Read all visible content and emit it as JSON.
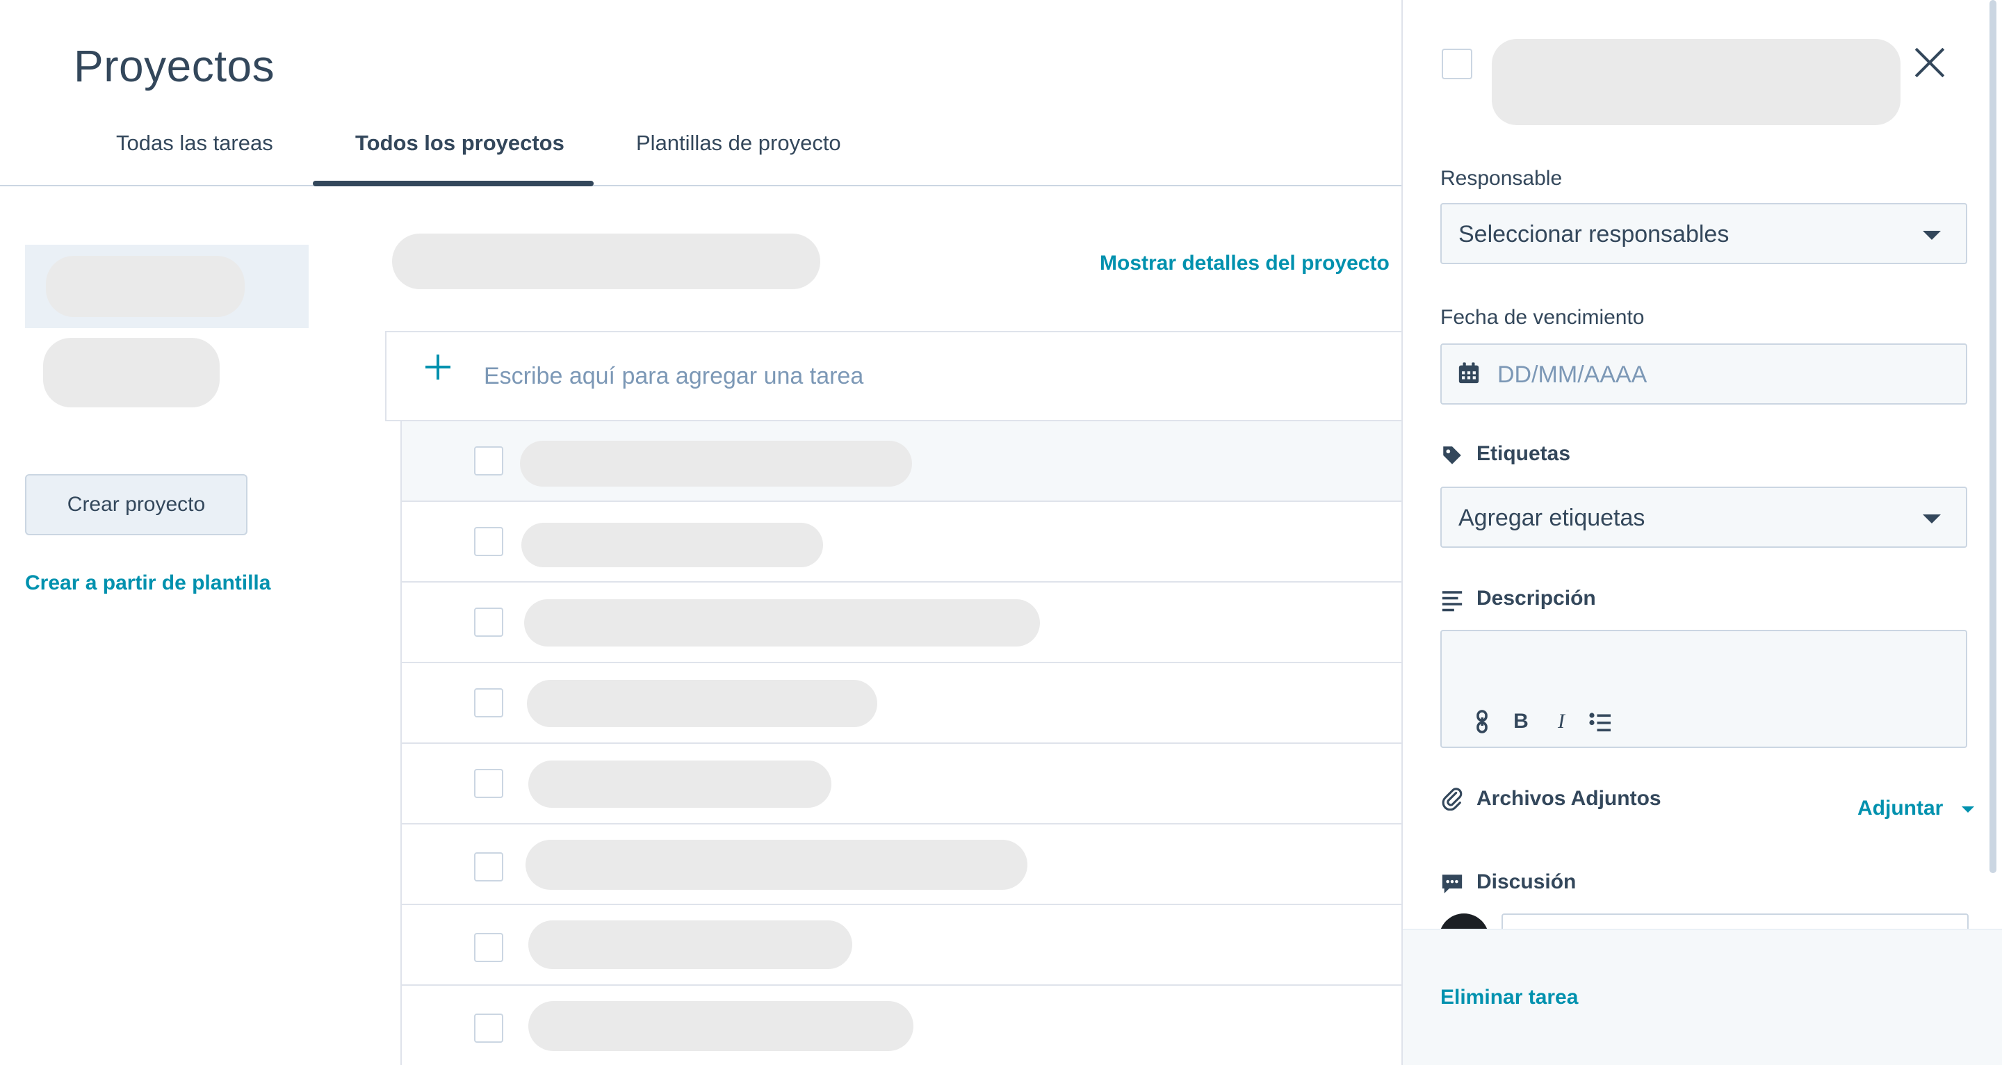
{
  "page": {
    "title": "Proyectos"
  },
  "tabs": [
    {
      "label": "Todas las tareas"
    },
    {
      "label": "Todos los proyectos",
      "active": true
    },
    {
      "label": "Plantillas de proyecto"
    }
  ],
  "sidebar": {
    "create_project_label": "Crear proyecto",
    "create_from_template_label": "Crear a partir de plantilla"
  },
  "project": {
    "show_details_label": "Mostrar detalles del proyecto",
    "add_task_placeholder": "Escribe aquí para agregar una tarea"
  },
  "task_panel": {
    "assignee_label": "Responsable",
    "assignee_value": "Seleccionar responsables",
    "due_date_label": "Fecha de vencimiento",
    "due_date_placeholder": "DD/MM/AAAA",
    "tags_label": "Etiquetas",
    "tags_value": "Agregar etiquetas",
    "description_label": "Descripción",
    "attachments_label": "Archivos Adjuntos",
    "attach_label": "Adjuntar",
    "discussion_label": "Discusión",
    "delete_label": "Eliminar tarea"
  },
  "colors": {
    "accent": "#0091ae",
    "text": "#33475b",
    "border": "#cbd6e2",
    "skeleton": "#eaeaea"
  },
  "icons": [
    "calendar-icon",
    "tag-icon",
    "align-left-icon",
    "paperclip-icon",
    "chat-icon",
    "link-icon",
    "bold-icon",
    "italic-icon",
    "list-icon",
    "close-icon",
    "plus-icon"
  ]
}
